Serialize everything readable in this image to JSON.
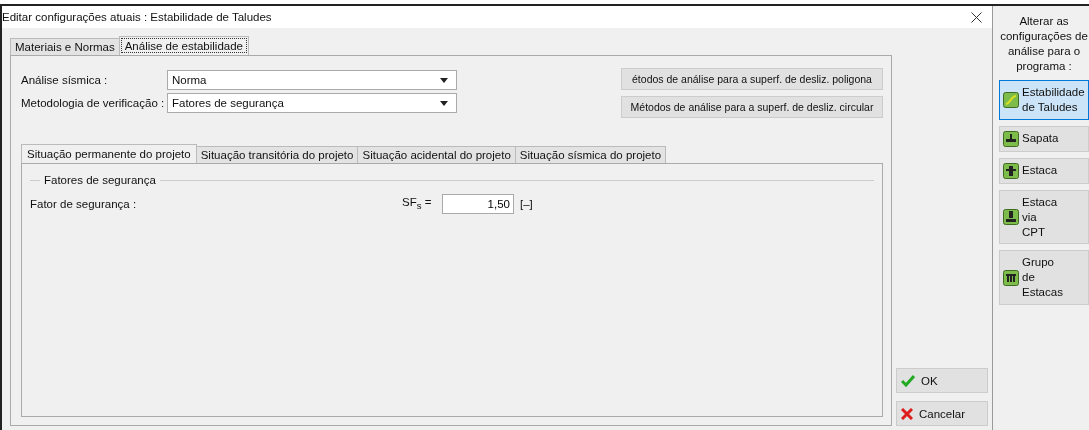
{
  "window": {
    "title": "Editar configurações atuais : Estabilidade de Taludes"
  },
  "outer_tabs": [
    {
      "label": "Materiais e Normas",
      "selected": false
    },
    {
      "label": "Análise de estabilidade",
      "selected": true
    }
  ],
  "fields": [
    {
      "label": "Análise sísmica :",
      "value": "Norma"
    },
    {
      "label": "Metodologia de verificação :",
      "value": "Fatores de segurança"
    }
  ],
  "method_buttons": [
    "étodos de análise para a superf. de desliz. poligona",
    "Métodos de análise para a superf. de desliz. circular"
  ],
  "inner_tabs": [
    {
      "label": "Situação permanente do projeto",
      "selected": true
    },
    {
      "label": "Situação transitória do projeto",
      "selected": false
    },
    {
      "label": "Situação acidental do projeto",
      "selected": false
    },
    {
      "label": "Situação sísmica do projeto",
      "selected": false
    }
  ],
  "group": {
    "title": "Fatores de segurança",
    "label": "Fator de segurança :",
    "symbol": "SF$_{s}$ =",
    "value": "1,50",
    "unit": "[–]"
  },
  "dialog_buttons": [
    {
      "label": "OK",
      "kind": "ok"
    },
    {
      "label": "Cancelar",
      "kind": "cancel"
    }
  ],
  "side_panel": {
    "heading": "Alterar as configurações de análise para o programa :",
    "programs": [
      {
        "label": "Estabilidade de Taludes",
        "kind": "slope",
        "selected": true
      },
      {
        "label": "Sapata",
        "kind": "footing",
        "selected": false
      },
      {
        "label": "Estaca",
        "kind": "pile",
        "selected": false
      },
      {
        "label": "Estaca via CPT",
        "kind": "cpt",
        "selected": false
      },
      {
        "label": "Grupo de Estacas",
        "kind": "group",
        "selected": false
      }
    ]
  }
}
